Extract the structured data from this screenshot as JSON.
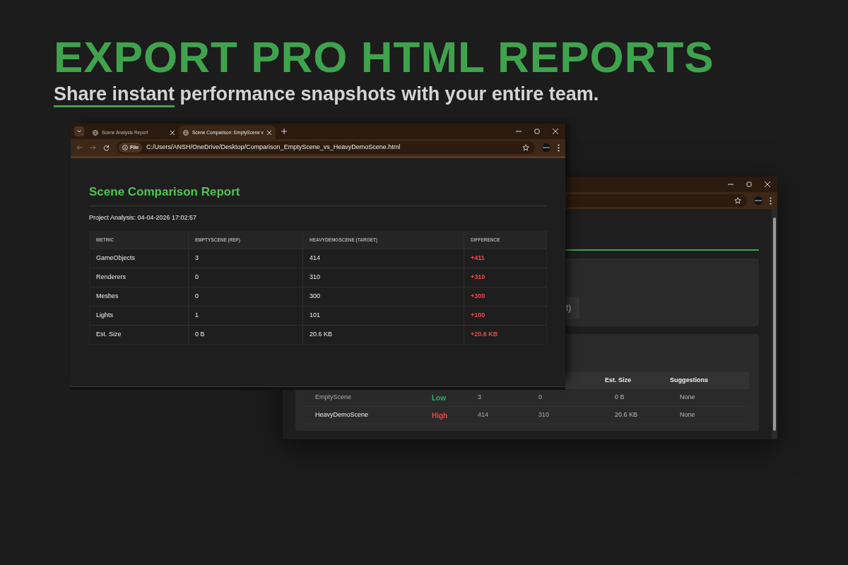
{
  "headline": "EXPORT PRO HTML REPORTS",
  "subheadline": {
    "underlined": "Share instant",
    "rest": " performance snapshots with your entire team."
  },
  "back_window": {
    "card_fragment": "t)",
    "table": {
      "columns": [
        "Est. Size",
        "Suggestions"
      ],
      "rows": [
        {
          "name": "EmptyScene",
          "risk": {
            "label": "Low",
            "color": "#2eae6b"
          },
          "column_3": "3",
          "column_4": "0",
          "est_size": "0 B",
          "suggestions": "None"
        },
        {
          "name": "HeavyDemoScene",
          "risk": {
            "label": "High",
            "color": "#e5484d"
          },
          "column_3": "414",
          "column_4": "310",
          "est_size": "20.6 KB",
          "suggestions": "None"
        }
      ]
    }
  },
  "front_window": {
    "tabs": [
      {
        "label": "Scene Analysis Report",
        "selected": false
      },
      {
        "label": "Scene Comparison: EmptyScene v",
        "selected": true
      }
    ],
    "address": {
      "chip": "File",
      "url": "C:/Users/ANSH/OneDrive/Desktop/Comparison_EmptyScene_vs_HeavyDemoScene.html"
    },
    "report": {
      "title": "Scene Comparison Report",
      "subtitle": "Project Analysis: 04-04-2026 17:02:57",
      "columns": [
        "METRIC",
        "EMPTYSCENE (REF)",
        "HEAVYDEMOSCENE (TARGET)",
        "DIFFERENCE"
      ],
      "rows": [
        {
          "metric": "GameObjects",
          "ref": "3",
          "target": "414",
          "difference": "+411"
        },
        {
          "metric": "Renderers",
          "ref": "0",
          "target": "310",
          "difference": "+310"
        },
        {
          "metric": "Meshes",
          "ref": "0",
          "target": "300",
          "difference": "+300"
        },
        {
          "metric": "Lights",
          "ref": "1",
          "target": "101",
          "difference": "+100"
        },
        {
          "metric": "Est. Size",
          "ref": "0 B",
          "target": "20.6 KB",
          "difference": "+20.6 KB"
        }
      ]
    }
  }
}
